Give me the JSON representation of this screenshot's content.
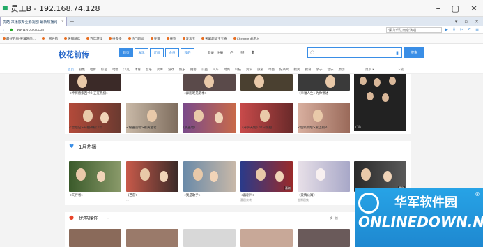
{
  "window": {
    "title": "员工B - 192.168.74.128",
    "controls": [
      "–",
      "▢",
      "✕"
    ]
  },
  "browser": {
    "tab_title": "优酷-来播放专业影视剧 最新热播网",
    "tab_close": "×",
    "tab_new": "+",
    "url": "www.youku.com",
    "side_search": "保力乐队南京演唱",
    "bookmarks": [
      "最好的局-天翼网内…",
      "上网导航",
      "天猫精选",
      "百年游戏",
      "拼多多",
      "热门新闻",
      "天猫",
      "搜狗",
      "爱淘宝",
      "天翼超级宝宝奇",
      "Chrome 必用入"
    ]
  },
  "site": {
    "logo": "校花前传",
    "header_tabs": [
      "首页",
      "发现",
      "订阅",
      "会员",
      "我的"
    ],
    "login": "登录",
    "register": "注册",
    "search_button": "搜索",
    "nav": [
      "首页",
      "剧集",
      "电影",
      "综艺",
      "动漫",
      "少儿",
      "体育",
      "音乐",
      "片库",
      "游戏",
      "娱乐",
      "拍客",
      "公益",
      "汽车",
      "时尚",
      "科技",
      "资讯",
      "旅游",
      "母婴",
      "纪录片",
      "搞笑",
      "教育",
      "亲子",
      "音乐",
      "原创"
    ],
    "nav_more": "更多 ▾",
    "nav_download": "下载"
  },
  "section1": {
    "top_captions": [
      "<神探普索西卡2 正在热播>",
      "<奔跑吧兄弟季>",
      "…",
      "《幸福人生>为你讲述"
    ],
    "row2": [
      {
        "cap": "<普坦记>开拍神秘少年",
        "sub": ""
      },
      {
        "cap": "<秘蛊遥物>看黄金老",
        "sub": ""
      },
      {
        "cap": "(秋蛊地)",
        "sub": ""
      },
      {
        "cap": "《守护天使》今日热拍",
        "sub": ""
      },
      {
        "cap": "<超级新娘>爱上别人",
        "sub": ""
      },
      {
        "cap": "",
        "sub": ""
      }
    ],
    "tall_label": "广告"
  },
  "section2": {
    "title": "1月热播",
    "items": [
      {
        "cap": "<天行者>",
        "sub": ""
      },
      {
        "cap": "《西游>",
        "sub": "…"
      },
      {
        "cap": "<我是歌手>",
        "sub": ""
      },
      {
        "cap": "<喜剧人>",
        "sub": "喜剧来袭"
      },
      {
        "cap": "《爱情公寓》",
        "sub": "金牌剧集"
      },
      {
        "cap": "<天天向上>",
        "sub": ""
      }
    ],
    "badges": [
      "",
      "",
      "",
      "喜剧",
      "",
      "乐讯",
      "喜剧"
    ]
  },
  "section3": {
    "title": "优酷懂你",
    "hint": "…",
    "more": "换一换"
  },
  "watermark": {
    "cn": "华军软件园",
    "en": "ONLINEDOWN.NET",
    "registered": "®"
  },
  "colors": {
    "accent": "#3a8ee6",
    "logo": "#2466c9",
    "watermark": "#1e88d0"
  }
}
